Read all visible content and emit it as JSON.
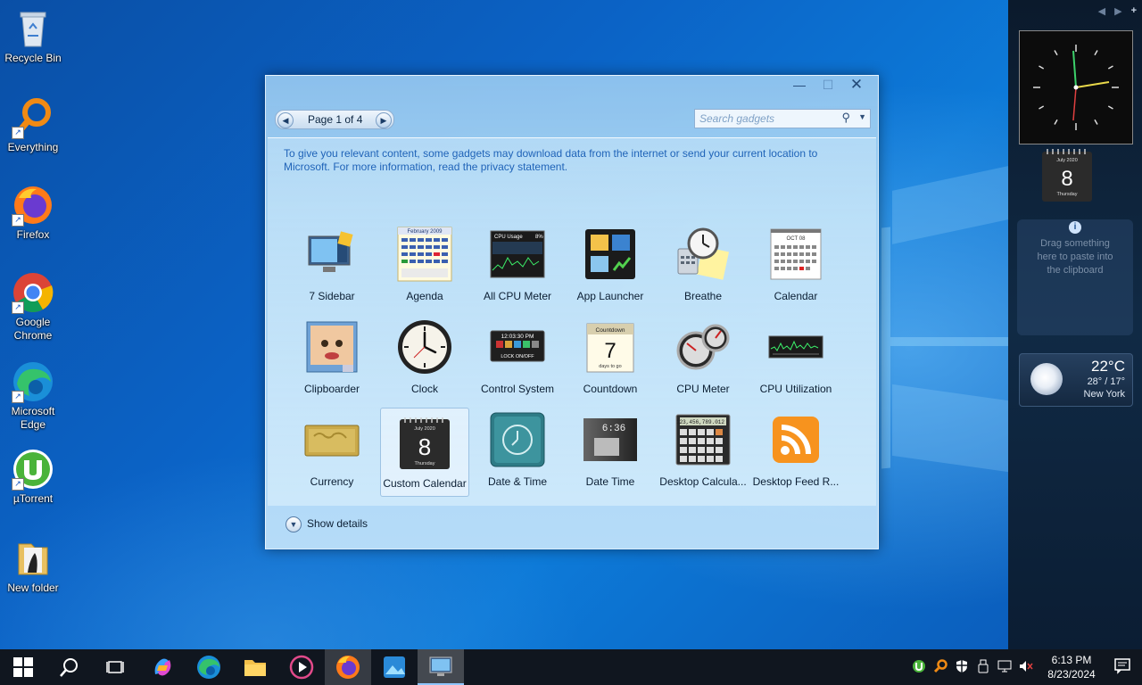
{
  "desktop": {
    "icons": [
      {
        "label": "Recycle Bin"
      },
      {
        "label": "Everything"
      },
      {
        "label": "Firefox"
      },
      {
        "label": "Google Chrome"
      },
      {
        "label": "Microsoft Edge"
      },
      {
        "label": "µTorrent"
      },
      {
        "label": "New folder"
      }
    ]
  },
  "gallery": {
    "pager": {
      "label": "Page 1 of 4"
    },
    "search": {
      "placeholder": "Search gadgets"
    },
    "privacy_text": "To give you relevant content, some gadgets may download data from the internet or send your current location to Microsoft. For more information, read the privacy statement.",
    "gadgets": [
      {
        "name": "7 Sidebar"
      },
      {
        "name": "Agenda"
      },
      {
        "name": "All CPU Meter"
      },
      {
        "name": "App Launcher"
      },
      {
        "name": "Breathe"
      },
      {
        "name": "Calendar"
      },
      {
        "name": "Clipboarder"
      },
      {
        "name": "Clock"
      },
      {
        "name": "Control System"
      },
      {
        "name": "Countdown"
      },
      {
        "name": "CPU Meter"
      },
      {
        "name": "CPU Utilization"
      },
      {
        "name": "Currency"
      },
      {
        "name": "Custom Calendar"
      },
      {
        "name": "Date & Time"
      },
      {
        "name": "Date Time"
      },
      {
        "name": "Desktop Calcula..."
      },
      {
        "name": "Desktop Feed R..."
      }
    ],
    "selected_gadget": "Custom Calendar",
    "thumb_text": {
      "agenda_month": "February 2009",
      "cpu_usage": "CPU Usage",
      "cpu_percent": "8%",
      "calendar_month": "OCT 08",
      "control_time": "12:03:30 PM",
      "control_lock": "LOCK ON/OFF",
      "countdown_title": "Countdown",
      "countdown_num": "7",
      "countdown_sub": "days to go",
      "custom_cal_month": "July 2020",
      "custom_cal_day": "8",
      "custom_cal_weekday": "Thursday",
      "date_time_display": "6:36",
      "calc_display": "123,456,789.012"
    },
    "show_details": "Show details"
  },
  "sidebar": {
    "cal_month": "July 2020",
    "cal_day": "8",
    "cal_weekday": "Thursday",
    "clipboard_hint": "Drag something here to paste into the clipboard",
    "weather": {
      "temp": "22°C",
      "hilo": "28° / 17°",
      "city": "New York"
    }
  },
  "taskbar": {
    "clock_time": "6:13 PM",
    "clock_date": "8/23/2024"
  },
  "colors": {
    "accent": "#1f63b8",
    "taskbar": "#10161f"
  }
}
